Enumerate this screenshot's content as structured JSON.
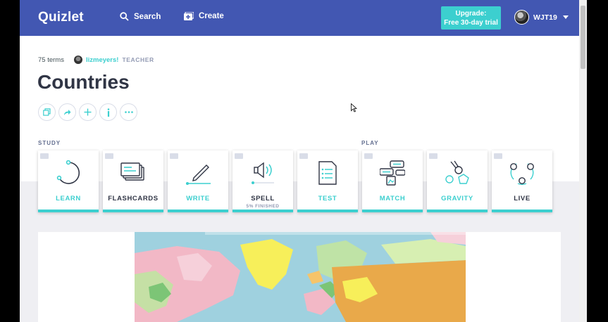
{
  "topbar": {
    "logo": "Quizlet",
    "search_label": "Search",
    "create_label": "Create",
    "upgrade_line1": "Upgrade:",
    "upgrade_line2": "Free 30-day trial",
    "username": "WJT19"
  },
  "set": {
    "terms": "75 terms",
    "author": "lizmeyers!",
    "role": "TEACHER",
    "title": "Countries"
  },
  "sections": {
    "study": "STUDY",
    "play": "PLAY"
  },
  "modes": [
    {
      "label": "LEARN",
      "icon": "learn-icon",
      "color": "#3ccfcf"
    },
    {
      "label": "FLASHCARDS",
      "icon": "flashcards-icon",
      "color": "#303545"
    },
    {
      "label": "WRITE",
      "icon": "write-icon",
      "color": "#3ccfcf"
    },
    {
      "label": "SPELL",
      "sub": "5% FINISHED",
      "icon": "spell-icon",
      "color": "#303545"
    },
    {
      "label": "TEST",
      "icon": "test-icon",
      "color": "#3ccfcf"
    },
    {
      "label": "MATCH",
      "icon": "match-icon",
      "color": "#3ccfcf"
    },
    {
      "label": "GRAVITY",
      "icon": "gravity-icon",
      "color": "#3ccfcf"
    },
    {
      "label": "LIVE",
      "icon": "live-icon",
      "color": "#303545"
    }
  ],
  "colors": {
    "brand": "#4257b2",
    "accent": "#3ccfcf",
    "text_dark": "#303545"
  }
}
